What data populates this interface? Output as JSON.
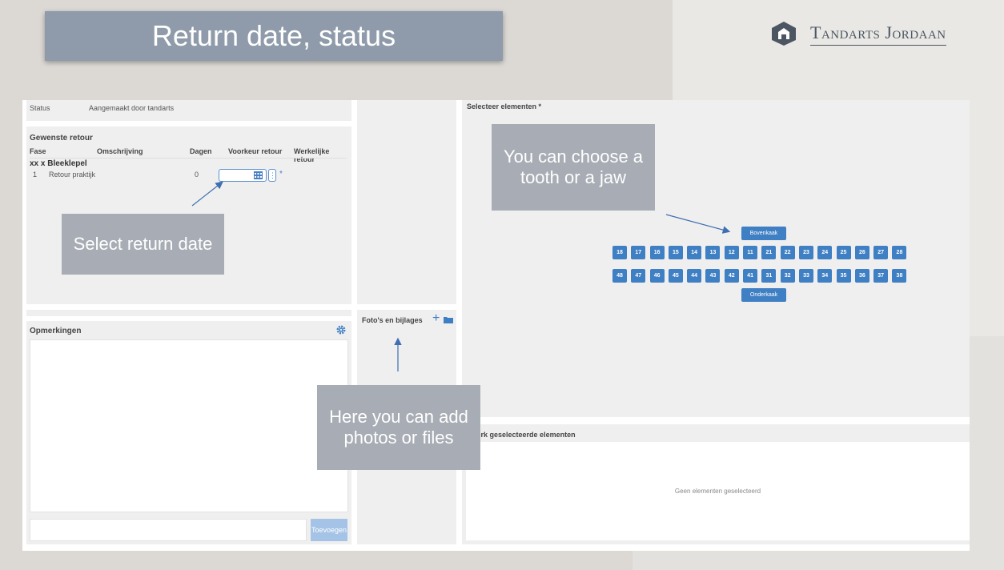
{
  "slide": {
    "title": "Return date, status",
    "brand": "Tandarts Jordaan"
  },
  "status": {
    "label": "Status",
    "value": "Aangemaakt door tandarts"
  },
  "retour": {
    "title": "Gewenste retour",
    "columns": [
      "Fase",
      "Omschrijving",
      "Dagen",
      "Voorkeur retour",
      "Werkelijke retour"
    ],
    "group": "xx x Bleeklepel",
    "row": {
      "fase": "1",
      "omschrijving": "Retour praktijk",
      "dagen": "0"
    },
    "required_mark": "*"
  },
  "opmerkingen": {
    "title": "Opmerkingen",
    "add_label": "Toevoegen"
  },
  "fotos": {
    "title": "Foto's en bijlages",
    "plus": "+"
  },
  "elements": {
    "title": "Selecteer elementen *",
    "upper_jaw": "Bovenkaak",
    "lower_jaw": "Onderkaak",
    "upper_teeth": [
      "18",
      "17",
      "16",
      "15",
      "14",
      "13",
      "12",
      "11",
      "21",
      "22",
      "23",
      "24",
      "25",
      "26",
      "27",
      "28"
    ],
    "lower_teeth": [
      "48",
      "47",
      "46",
      "45",
      "44",
      "43",
      "42",
      "41",
      "31",
      "32",
      "33",
      "34",
      "35",
      "36",
      "37",
      "38"
    ]
  },
  "bewerk": {
    "title": "Bewerk geselecteerde elementen",
    "empty": "Geen elementen geselecteerd"
  },
  "callouts": {
    "date": "Select return date",
    "tooth": "You can choose a tooth or a jaw",
    "photo": "Here you can add photos or files"
  },
  "colors": {
    "accent": "#3f7fc3",
    "callout": "#a8adb5",
    "title_bar": "#8f9baa"
  }
}
